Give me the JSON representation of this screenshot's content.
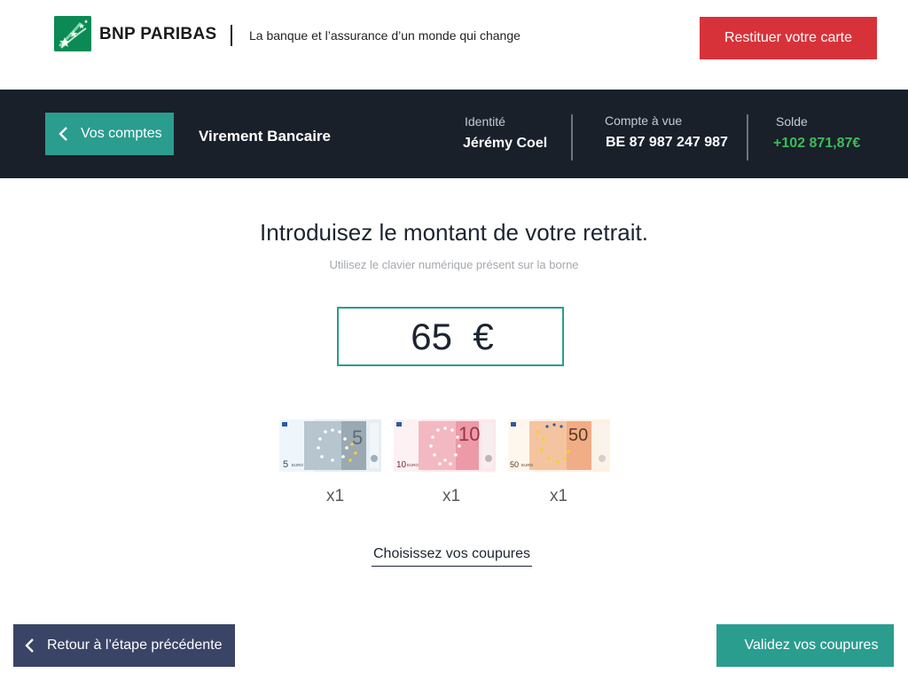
{
  "header": {
    "brand_name": "BNP PARIBAS",
    "tagline": "La banque et l’assurance d’un monde qui change",
    "return_card_label": "Restituer votre carte"
  },
  "nav": {
    "back_label": "Vos comptes",
    "page_title": "Virement Bancaire",
    "identity_label": "Identité",
    "identity_value": "Jérémy Coel",
    "account_label": "Compte à vue",
    "account_value": "BE 87 987 247 987",
    "balance_label": "Solde",
    "balance_value": "+102 871,87€"
  },
  "main": {
    "title": "Introduisez le montant de votre retrait.",
    "subtitle": "Utilisez le clavier numérique présent sur la borne",
    "amount": "65  €",
    "notes": [
      {
        "denomination": "5",
        "quantity": "x1",
        "currency_text": "EURO"
      },
      {
        "denomination": "10",
        "quantity": "x1",
        "currency_text": "EURO"
      },
      {
        "denomination": "50",
        "quantity": "x1",
        "currency_text": "EURO"
      }
    ],
    "choose_link": "Choisissez vos coupures"
  },
  "footer": {
    "back_label": "Retour à l’étape précédente",
    "validate_label": "Validez vos coupures"
  },
  "colors": {
    "brand_green": "#0b8a55",
    "teal": "#2a9d8f",
    "red": "#d7323a",
    "navy": "#19202a",
    "slate": "#3a4466",
    "balance_green": "#3fbb5a"
  },
  "icons": {
    "logo": "bnp-stars-logo",
    "back": "chevron-left-icon"
  }
}
